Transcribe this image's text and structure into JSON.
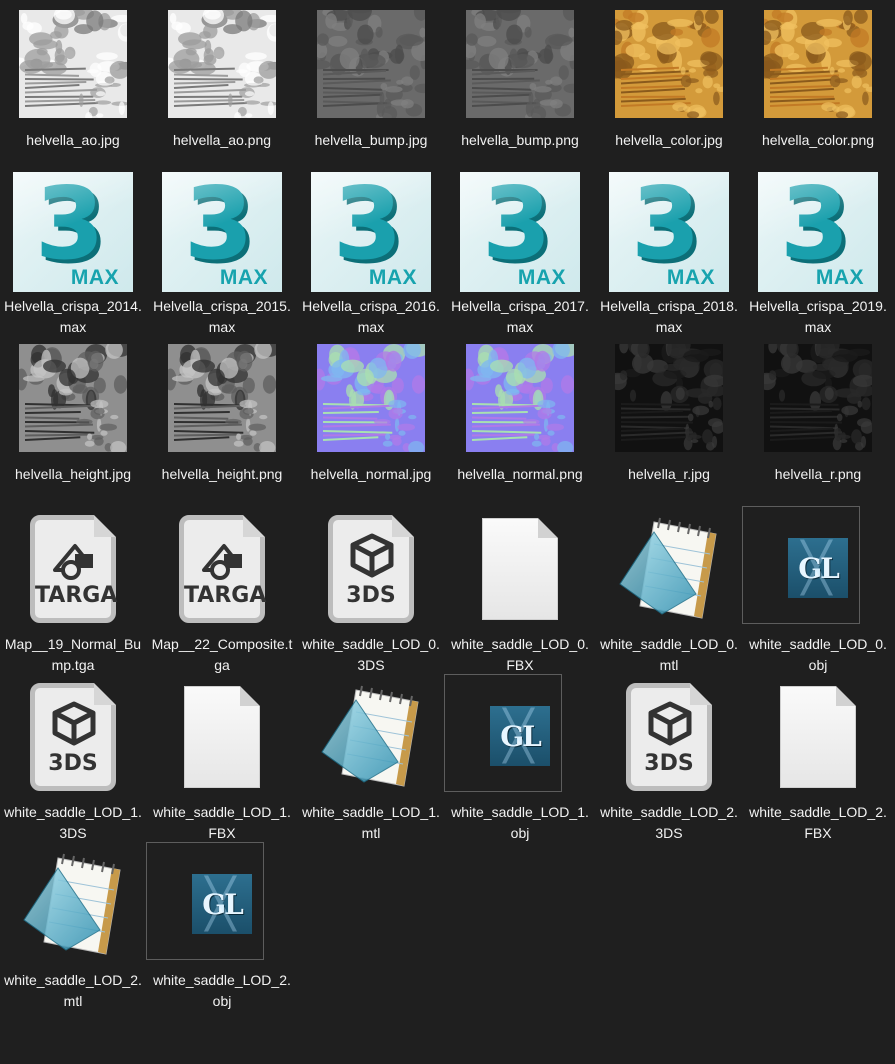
{
  "files": [
    {
      "name": "helvella_ao.jpg",
      "type": "texture",
      "texture": "ao"
    },
    {
      "name": "helvella_ao.png",
      "type": "texture",
      "texture": "ao"
    },
    {
      "name": "helvella_bump.jpg",
      "type": "texture",
      "texture": "bump"
    },
    {
      "name": "helvella_bump.png",
      "type": "texture",
      "texture": "bump"
    },
    {
      "name": "helvella_color.jpg",
      "type": "texture",
      "texture": "color"
    },
    {
      "name": "helvella_color.png",
      "type": "texture",
      "texture": "color"
    },
    {
      "name": "Helvella_crispa_2014.max",
      "type": "max",
      "icon_text": "MAX",
      "icon_digit": "3"
    },
    {
      "name": "Helvella_crispa_2015.max",
      "type": "max",
      "icon_text": "MAX",
      "icon_digit": "3"
    },
    {
      "name": "Helvella_crispa_2016.max",
      "type": "max",
      "icon_text": "MAX",
      "icon_digit": "3"
    },
    {
      "name": "Helvella_crispa_2017.max",
      "type": "max",
      "icon_text": "MAX",
      "icon_digit": "3"
    },
    {
      "name": "Helvella_crispa_2018.max",
      "type": "max",
      "icon_text": "MAX",
      "icon_digit": "3"
    },
    {
      "name": "Helvella_crispa_2019.max",
      "type": "max",
      "icon_text": "MAX",
      "icon_digit": "3"
    },
    {
      "name": "helvella_height.jpg",
      "type": "texture",
      "texture": "height"
    },
    {
      "name": "helvella_height.png",
      "type": "texture",
      "texture": "height"
    },
    {
      "name": "helvella_normal.jpg",
      "type": "texture",
      "texture": "normal"
    },
    {
      "name": "helvella_normal.png",
      "type": "texture",
      "texture": "normal"
    },
    {
      "name": "helvella_r.jpg",
      "type": "texture",
      "texture": "r"
    },
    {
      "name": "helvella_r.png",
      "type": "texture",
      "texture": "r"
    },
    {
      "name": "Map__19_Normal_Bump.tga",
      "type": "doc",
      "icon_text": "TARGA",
      "glyph": "targa"
    },
    {
      "name": "Map__22_Composite.tga",
      "type": "doc",
      "icon_text": "TARGA",
      "glyph": "targa"
    },
    {
      "name": "white_saddle_LOD_0.3DS",
      "type": "doc",
      "icon_text": "3DS",
      "glyph": "cube"
    },
    {
      "name": "white_saddle_LOD_0.FBX",
      "type": "blank"
    },
    {
      "name": "white_saddle_LOD_0.mtl",
      "type": "notepad"
    },
    {
      "name": "white_saddle_LOD_0.obj",
      "type": "gl",
      "icon_text": "GL",
      "outlined": true
    },
    {
      "name": "white_saddle_LOD_1.3DS",
      "type": "doc",
      "icon_text": "3DS",
      "glyph": "cube"
    },
    {
      "name": "white_saddle_LOD_1.FBX",
      "type": "blank"
    },
    {
      "name": "white_saddle_LOD_1.mtl",
      "type": "notepad"
    },
    {
      "name": "white_saddle_LOD_1.obj",
      "type": "gl",
      "icon_text": "GL",
      "outlined": true
    },
    {
      "name": "white_saddle_LOD_2.3DS",
      "type": "doc",
      "icon_text": "3DS",
      "glyph": "cube"
    },
    {
      "name": "white_saddle_LOD_2.FBX",
      "type": "blank"
    },
    {
      "name": "white_saddle_LOD_2.mtl",
      "type": "notepad"
    },
    {
      "name": "white_saddle_LOD_2.obj",
      "type": "gl",
      "icon_text": "GL",
      "outlined": true
    }
  ],
  "colors": {
    "background": "#1f1f1f",
    "label": "#f2f2f2",
    "max_teal": "#1aa0ad",
    "outline": "#5d5d5d"
  }
}
